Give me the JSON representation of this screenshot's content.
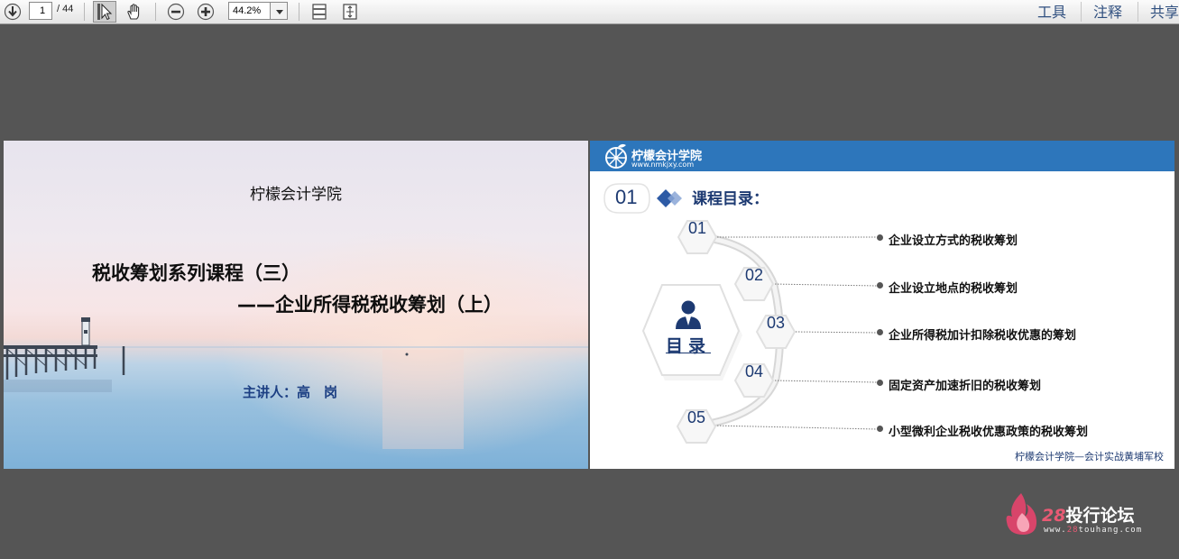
{
  "toolbar": {
    "page_current": "1",
    "page_total": "/ 44",
    "zoom": "44.2%",
    "links": [
      "工具",
      "注释",
      "共享"
    ]
  },
  "slide1": {
    "school": "柠檬会计学院",
    "title_line1": "税收筹划系列课程（三）",
    "title_line2": "——企业所得税税收筹划（上）",
    "speaker": "主讲人：高　岗"
  },
  "slide2": {
    "logo_text": "柠檬会计学院",
    "logo_url": "www.nmkjxy.com",
    "section_number": "01",
    "section_title": "课程目录：",
    "center_label": "目录",
    "items": [
      {
        "num": "01",
        "text": "企业设立方式的税收筹划"
      },
      {
        "num": "02",
        "text": "企业设立地点的税收筹划"
      },
      {
        "num": "03",
        "text": "企业所得税加计扣除税收优惠的筹划"
      },
      {
        "num": "04",
        "text": "固定资产加速折旧的税收筹划"
      },
      {
        "num": "05",
        "text": "小型微利企业税收优惠政策的税收筹划"
      }
    ],
    "footer": "柠檬会计学院—会计实战黄埔军校"
  },
  "watermark": {
    "number": "28",
    "name": "投行论坛",
    "url_prefix": "www.",
    "url_accent": "28",
    "url_suffix": "touhang.com"
  },
  "colors": {
    "app_background": "#555555",
    "slide_header": "#2d76bb",
    "navy_text": "#1d3a72",
    "accent_pink": "#e85a74"
  },
  "icons": [
    "download-arrow-icon",
    "select-cursor-icon",
    "hand-tool-icon",
    "zoom-out-icon",
    "zoom-in-icon",
    "fit-width-icon",
    "fit-page-icon",
    "person-icon",
    "flame-logo-icon"
  ]
}
